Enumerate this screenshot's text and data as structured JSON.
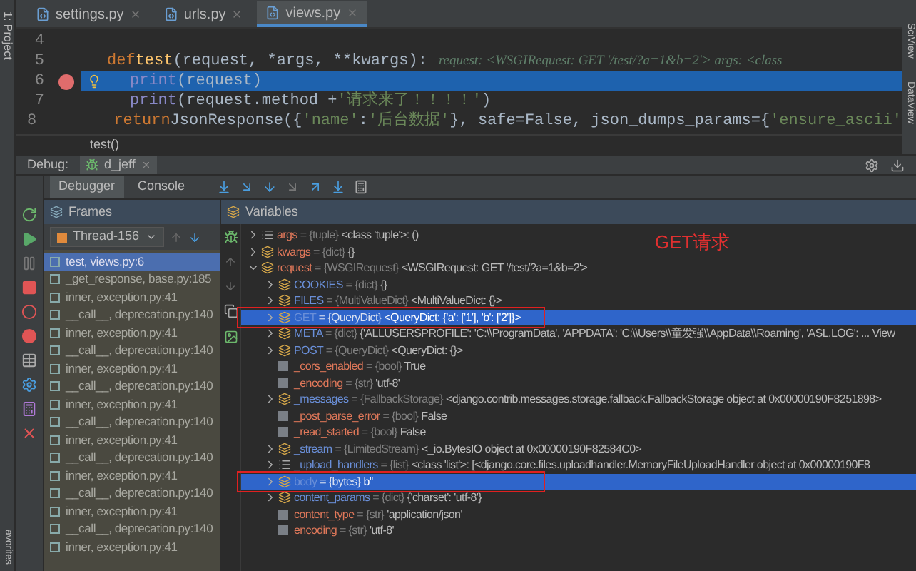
{
  "side_strip": {
    "project_label": "1: Project",
    "favorites_label": "avorites"
  },
  "right_strip": [
    "SciView",
    "DataView"
  ],
  "editor_tabs": [
    {
      "label": "settings.py",
      "selected": false
    },
    {
      "label": "urls.py",
      "selected": false
    },
    {
      "label": "views.py",
      "selected": true
    }
  ],
  "code_lines": [
    {
      "number": "4",
      "current": false,
      "breakpoint": false
    },
    {
      "number": "5",
      "current": false,
      "breakpoint": false,
      "tokens": [
        {
          "text": "def",
          "kind": "keyword"
        },
        {
          "text": " test",
          "kind": "function"
        },
        {
          "text": "(request, *args, **kwargs):",
          "kind": "plain"
        }
      ],
      "hint": "request: <WSGIRequest: GET '/test/?a=1&b=2'>  args: <class"
    },
    {
      "number": "6",
      "current": true,
      "breakpoint": true,
      "tokens": [
        {
          "text": "print",
          "kind": "builtin"
        },
        {
          "text": "(request)",
          "kind": "plain"
        }
      ]
    },
    {
      "number": "7",
      "current": false,
      "breakpoint": false,
      "tokens": [
        {
          "text": "print",
          "kind": "builtin"
        },
        {
          "text": "(request.method + ",
          "kind": "plain"
        },
        {
          "text": "'请求来了！！！！'",
          "kind": "string"
        },
        {
          "text": ")",
          "kind": "plain"
        }
      ]
    },
    {
      "number": "8",
      "current": false,
      "breakpoint": false,
      "tokens": [
        {
          "text": "return",
          "kind": "keyword"
        },
        {
          "text": " JsonResponse({",
          "kind": "plain"
        },
        {
          "text": "'name'",
          "kind": "string"
        },
        {
          "text": ":",
          "kind": "plain"
        },
        {
          "text": "'后台数据'",
          "kind": "string"
        },
        {
          "text": "}, safe=False, json_dumps_params={",
          "kind": "plain"
        },
        {
          "text": "'ensure_ascii'",
          "kind": "string"
        }
      ]
    }
  ],
  "breadcrumb": "test()",
  "debug_bar": {
    "label": "Debug:",
    "config": "d_jeff"
  },
  "debugger_tabs": [
    {
      "label": "Debugger",
      "selected": true
    },
    {
      "label": "Console",
      "selected": false
    }
  ],
  "frames": {
    "title": "Frames",
    "thread": "Thread-156",
    "items": [
      {
        "label": "test, views.py:6",
        "selected": true
      },
      {
        "label": "_get_response, base.py:185",
        "selected": false
      },
      {
        "label": "inner, exception.py:41",
        "selected": false
      },
      {
        "label": "__call__, deprecation.py:140",
        "selected": false
      },
      {
        "label": "inner, exception.py:41",
        "selected": false
      },
      {
        "label": "__call__, deprecation.py:140",
        "selected": false
      },
      {
        "label": "inner, exception.py:41",
        "selected": false
      },
      {
        "label": "__call__, deprecation.py:140",
        "selected": false
      },
      {
        "label": "inner, exception.py:41",
        "selected": false
      },
      {
        "label": "__call__, deprecation.py:140",
        "selected": false
      },
      {
        "label": "inner, exception.py:41",
        "selected": false
      },
      {
        "label": "__call__, deprecation.py:140",
        "selected": false
      },
      {
        "label": "inner, exception.py:41",
        "selected": false
      },
      {
        "label": "__call__, deprecation.py:140",
        "selected": false
      },
      {
        "label": "inner, exception.py:41",
        "selected": false
      },
      {
        "label": "__call__, deprecation.py:140",
        "selected": false
      },
      {
        "label": "inner, exception.py:41",
        "selected": false
      }
    ]
  },
  "variables": {
    "title": "Variables",
    "annotation": "GET请求",
    "items": [
      {
        "name": "args",
        "type": "= {tuple}",
        "value": "<class 'tuple'>: ()",
        "kind": "list",
        "color": "#e0785a",
        "expanded": false,
        "selected": false,
        "boxed": false
      },
      {
        "name": "kwargs",
        "type": "= {dict}",
        "value": "{}",
        "kind": "object",
        "color": "#e0785a",
        "expanded": false,
        "selected": false,
        "boxed": false
      },
      {
        "name": "request",
        "type": "= {WSGIRequest}",
        "value": "<WSGIRequest: GET '/test/?a=1&b=2'>",
        "kind": "object",
        "color": "#e0785a",
        "expanded": true,
        "selected": false,
        "boxed": false,
        "children": [
          {
            "name": "COOKIES",
            "type": "= {dict}",
            "value": "{}",
            "kind": "object",
            "color": "#6a8fd8",
            "expanded": false,
            "selected": false,
            "boxed": false
          },
          {
            "name": "FILES",
            "type": "= {MultiValueDict}",
            "value": "<MultiValueDict: {}>",
            "kind": "object",
            "color": "#6a8fd8",
            "expanded": false,
            "selected": false,
            "boxed": false
          },
          {
            "name": "GET",
            "type": "= {QueryDict}",
            "value": "<QueryDict: {'a': ['1'], 'b': ['2']}>",
            "kind": "object",
            "color": "#6a8fd8",
            "expanded": false,
            "selected": true,
            "boxed": true
          },
          {
            "name": "META",
            "type": "= {dict}",
            "value": "{'ALLUSERSPROFILE': 'C:\\\\ProgramData', 'APPDATA': 'C:\\\\Users\\\\童发强\\\\AppData\\\\Roaming', 'ASL.LOG': ... View",
            "kind": "object",
            "color": "#6a8fd8",
            "expanded": false,
            "selected": false,
            "boxed": false
          },
          {
            "name": "POST",
            "type": "= {QueryDict}",
            "value": "<QueryDict: {}>",
            "kind": "object",
            "color": "#6a8fd8",
            "expanded": false,
            "selected": false,
            "boxed": false
          },
          {
            "name": "_cors_enabled",
            "type": "= {bool}",
            "value": "True",
            "kind": "field",
            "color": "#e0785a",
            "selected": false,
            "boxed": false
          },
          {
            "name": "_encoding",
            "type": "= {str}",
            "value": "'utf-8'",
            "kind": "field",
            "color": "#e0785a",
            "selected": false,
            "boxed": false
          },
          {
            "name": "_messages",
            "type": "= {FallbackStorage}",
            "value": "<django.contrib.messages.storage.fallback.FallbackStorage object at 0x00000190F8251898>",
            "kind": "object",
            "color": "#6a8fd8",
            "expanded": false,
            "selected": false,
            "boxed": false
          },
          {
            "name": "_post_parse_error",
            "type": "= {bool}",
            "value": "False",
            "kind": "field",
            "color": "#e0785a",
            "selected": false,
            "boxed": false
          },
          {
            "name": "_read_started",
            "type": "= {bool}",
            "value": "False",
            "kind": "field",
            "color": "#e0785a",
            "selected": false,
            "boxed": false
          },
          {
            "name": "_stream",
            "type": "= {LimitedStream}",
            "value": "<_io.BytesIO object at 0x00000190F82584C0>",
            "kind": "object",
            "color": "#6a8fd8",
            "expanded": false,
            "selected": false,
            "boxed": false
          },
          {
            "name": "_upload_handlers",
            "type": "= {list}",
            "value": "<class 'list'>: [<django.core.files.uploadhandler.MemoryFileUploadHandler object at 0x00000190F8",
            "kind": "list",
            "color": "#6a8fd8",
            "expanded": false,
            "selected": false,
            "boxed": false
          },
          {
            "name": "body",
            "type": "= {bytes}",
            "value": "b''",
            "kind": "object",
            "color": "#6a8fd8",
            "expanded": false,
            "selected": true,
            "boxed": true
          },
          {
            "name": "content_params",
            "type": "= {dict}",
            "value": "{'charset': 'utf-8'}",
            "kind": "object",
            "color": "#6a8fd8",
            "expanded": false,
            "selected": false,
            "boxed": false
          },
          {
            "name": "content_type",
            "type": "= {str}",
            "value": "'application/json'",
            "kind": "field",
            "color": "#e0785a",
            "selected": false,
            "boxed": false
          },
          {
            "name": "encoding",
            "type": "= {str}",
            "value": "'utf-8'",
            "kind": "field",
            "color": "#e0785a",
            "selected": false,
            "boxed": false
          }
        ]
      }
    ]
  }
}
